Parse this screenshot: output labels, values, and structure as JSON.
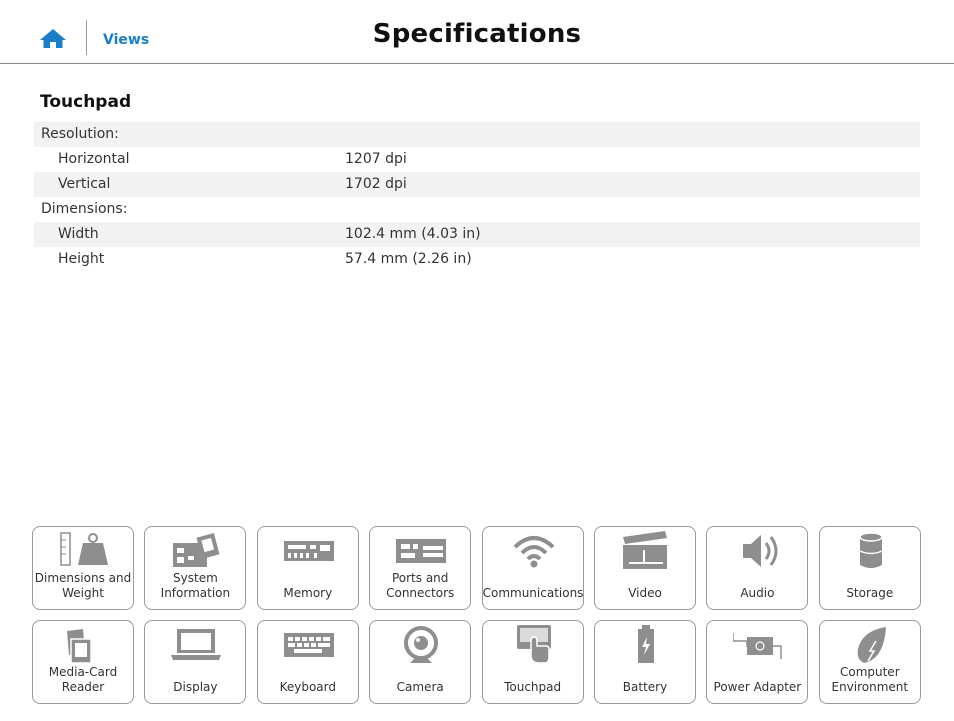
{
  "header": {
    "views_label": "Views",
    "title": "Specifications"
  },
  "section": {
    "title": "Touchpad"
  },
  "specs": [
    {
      "label": "Resolution:",
      "value": "",
      "indent": false,
      "shaded": true
    },
    {
      "label": "Horizontal",
      "value": "1207 dpi",
      "indent": true,
      "shaded": false
    },
    {
      "label": "Vertical",
      "value": "1702 dpi",
      "indent": true,
      "shaded": true
    },
    {
      "label": "Dimensions:",
      "value": "",
      "indent": false,
      "shaded": false
    },
    {
      "label": "Width",
      "value": "102.4 mm (4.03 in)",
      "indent": true,
      "shaded": true
    },
    {
      "label": "Height",
      "value": "57.4 mm (2.26 in)",
      "indent": true,
      "shaded": false
    }
  ],
  "tiles": [
    {
      "label": "Dimensions and Weight",
      "icon": "dimensions-weight-icon"
    },
    {
      "label": "System Information",
      "icon": "system-information-icon"
    },
    {
      "label": "Memory",
      "icon": "memory-icon"
    },
    {
      "label": "Ports and Connectors",
      "icon": "ports-connectors-icon"
    },
    {
      "label": "Communications",
      "icon": "wifi-icon"
    },
    {
      "label": "Video",
      "icon": "video-clapperboard-icon"
    },
    {
      "label": "Audio",
      "icon": "speaker-icon"
    },
    {
      "label": "Storage",
      "icon": "storage-cylinder-icon"
    },
    {
      "label": "Media-Card Reader",
      "icon": "media-card-icon"
    },
    {
      "label": "Display",
      "icon": "laptop-display-icon"
    },
    {
      "label": "Keyboard",
      "icon": "keyboard-icon"
    },
    {
      "label": "Camera",
      "icon": "webcam-icon"
    },
    {
      "label": "Touchpad",
      "icon": "touchpad-icon"
    },
    {
      "label": "Battery",
      "icon": "battery-icon"
    },
    {
      "label": "Power Adapter",
      "icon": "power-adapter-icon"
    },
    {
      "label": "Computer Environment",
      "icon": "leaf-icon"
    }
  ],
  "colors": {
    "accent": "#1a7ec8",
    "icon_gray": "#8e8e8e",
    "row_shade": "#f2f2f2"
  }
}
